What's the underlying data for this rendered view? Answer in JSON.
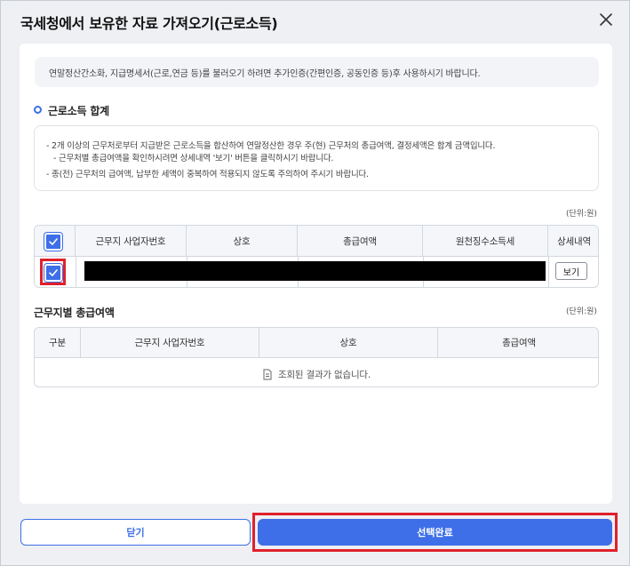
{
  "modal": {
    "title": "국세청에서 보유한 자료 가져오기(근로소득)"
  },
  "notice": {
    "text": "연말정산간소화, 지급명세서(근로,연금 등)를 불러오기 하려면 추가인증(간편인증, 공동인증 등)후 사용하시기 바랍니다."
  },
  "section1": {
    "title": "근로소득 합계",
    "guide": [
      "- 2개 이상의 근무처로부터 지급받은 근로소득을 합산하여 연말정산한 경우 주(현) 근무처의 총급여액, 결정세액은 합계 금액입니다.",
      "- 근무처별 총급여액을 확인하시려면 상세내역 '보기' 버튼을 클릭하시기 바랍니다.",
      "- 종(전) 근무처의 급여액, 납부한 세액이 중복하여 적용되지 않도록 주의하여 주시기 바랍니다."
    ],
    "unit": "(단위:원)",
    "table": {
      "headers": [
        "근무지 사업자번호",
        "상호",
        "총급여액",
        "원천징수소득세",
        "상세내역"
      ],
      "row": {
        "checked": true,
        "view_label": "보기"
      }
    }
  },
  "section2": {
    "title": "근무지별 총급여액",
    "unit": "(단위:원)",
    "table": {
      "headers": [
        "구분",
        "근무지 사업자번호",
        "상호",
        "총급여액"
      ],
      "empty_message": "조회된 결과가 없습니다."
    }
  },
  "footer": {
    "close_label": "닫기",
    "confirm_label": "선택완료"
  },
  "colors": {
    "accent": "#3e6fe8",
    "highlight": "#e0202a"
  }
}
